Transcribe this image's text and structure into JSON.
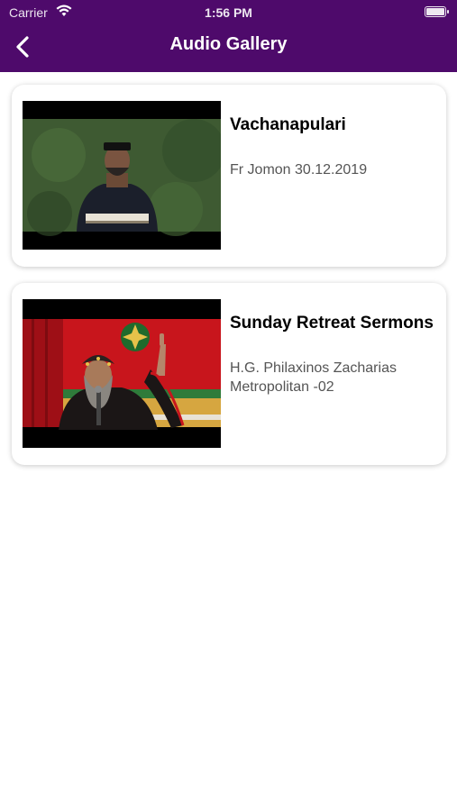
{
  "status_bar": {
    "carrier": "Carrier",
    "time": "1:56 PM"
  },
  "nav": {
    "title": "Audio Gallery",
    "back_icon": "chevron-left-icon"
  },
  "colors": {
    "nav_background": "#4e0a6b",
    "title_text": "#000000",
    "subtitle_text": "#555555"
  },
  "gallery": {
    "items": [
      {
        "title": "Vachanapulari",
        "subtitle": "Fr Jomon 30.12.2019"
      },
      {
        "title": "Sunday Retreat Sermons",
        "subtitle": "H.G. Philaxinos Zacharias Metropolitan -02"
      }
    ]
  }
}
